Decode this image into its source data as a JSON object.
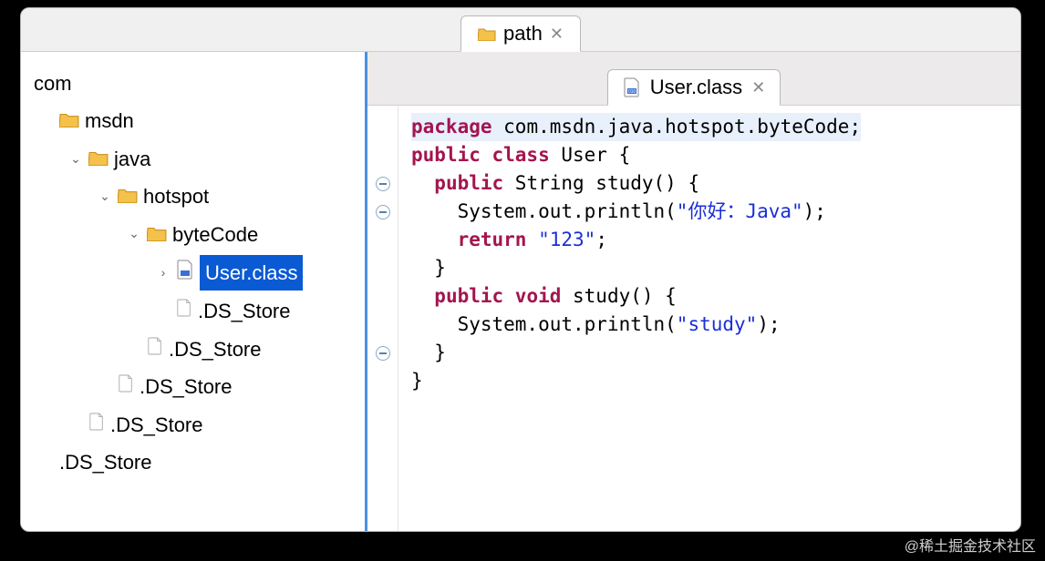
{
  "topTab": {
    "label": "path"
  },
  "tree": {
    "root": "com",
    "items": [
      {
        "depth": 0,
        "type": "folder",
        "arrow": "none",
        "label": "msdn"
      },
      {
        "depth": 1,
        "type": "folder",
        "arrow": "down",
        "label": "java"
      },
      {
        "depth": 2,
        "type": "folder",
        "arrow": "down",
        "label": "hotspot"
      },
      {
        "depth": 3,
        "type": "folder",
        "arrow": "down",
        "label": "byteCode"
      },
      {
        "depth": 4,
        "type": "class",
        "arrow": "right",
        "label": "User.class",
        "selected": true
      },
      {
        "depth": 4,
        "type": "file",
        "arrow": "none",
        "label": ".DS_Store"
      },
      {
        "depth": 3,
        "type": "file",
        "arrow": "none",
        "label": ".DS_Store"
      },
      {
        "depth": 2,
        "type": "file",
        "arrow": "none",
        "label": ".DS_Store"
      },
      {
        "depth": 1,
        "type": "file",
        "arrow": "none",
        "label": ".DS_Store"
      },
      {
        "depth": 0,
        "type": "text",
        "arrow": "none",
        "label": ".DS_Store"
      }
    ]
  },
  "editorTab": {
    "label": "User.class"
  },
  "code": {
    "lines": [
      {
        "hl": true,
        "fold": "",
        "tokens": [
          [
            "kw",
            "package"
          ],
          [
            "txt",
            " com.msdn.java.hotspot.byteCode;"
          ]
        ]
      },
      {
        "hl": false,
        "fold": "",
        "tokens": [
          [
            "txt",
            ""
          ]
        ]
      },
      {
        "hl": false,
        "fold": "o",
        "tokens": [
          [
            "kw",
            "public class"
          ],
          [
            "txt",
            " User {"
          ]
        ]
      },
      {
        "hl": false,
        "fold": "o",
        "tokens": [
          [
            "txt",
            "  "
          ],
          [
            "kw",
            "public"
          ],
          [
            "txt",
            " String study() {"
          ]
        ]
      },
      {
        "hl": false,
        "fold": "",
        "tokens": [
          [
            "txt",
            "    System.out.println("
          ],
          [
            "str",
            "\"你好：Java\""
          ],
          [
            "txt",
            ");"
          ]
        ]
      },
      {
        "hl": false,
        "fold": "",
        "tokens": [
          [
            "txt",
            "    "
          ],
          [
            "kw",
            "return"
          ],
          [
            "txt",
            " "
          ],
          [
            "str",
            "\"123\""
          ],
          [
            "txt",
            ";"
          ]
        ]
      },
      {
        "hl": false,
        "fold": "",
        "tokens": [
          [
            "txt",
            "  }"
          ]
        ]
      },
      {
        "hl": false,
        "fold": "",
        "tokens": [
          [
            "txt",
            ""
          ]
        ]
      },
      {
        "hl": false,
        "fold": "o",
        "tokens": [
          [
            "txt",
            "  "
          ],
          [
            "kw",
            "public void"
          ],
          [
            "txt",
            " study() {"
          ]
        ]
      },
      {
        "hl": false,
        "fold": "",
        "tokens": [
          [
            "txt",
            "    System.out.println("
          ],
          [
            "str",
            "\"study\""
          ],
          [
            "txt",
            ");"
          ]
        ]
      },
      {
        "hl": false,
        "fold": "",
        "tokens": [
          [
            "txt",
            "  }"
          ]
        ]
      },
      {
        "hl": false,
        "fold": "",
        "tokens": [
          [
            "txt",
            "}"
          ]
        ]
      }
    ]
  },
  "watermark": "@稀土掘金技术社区"
}
